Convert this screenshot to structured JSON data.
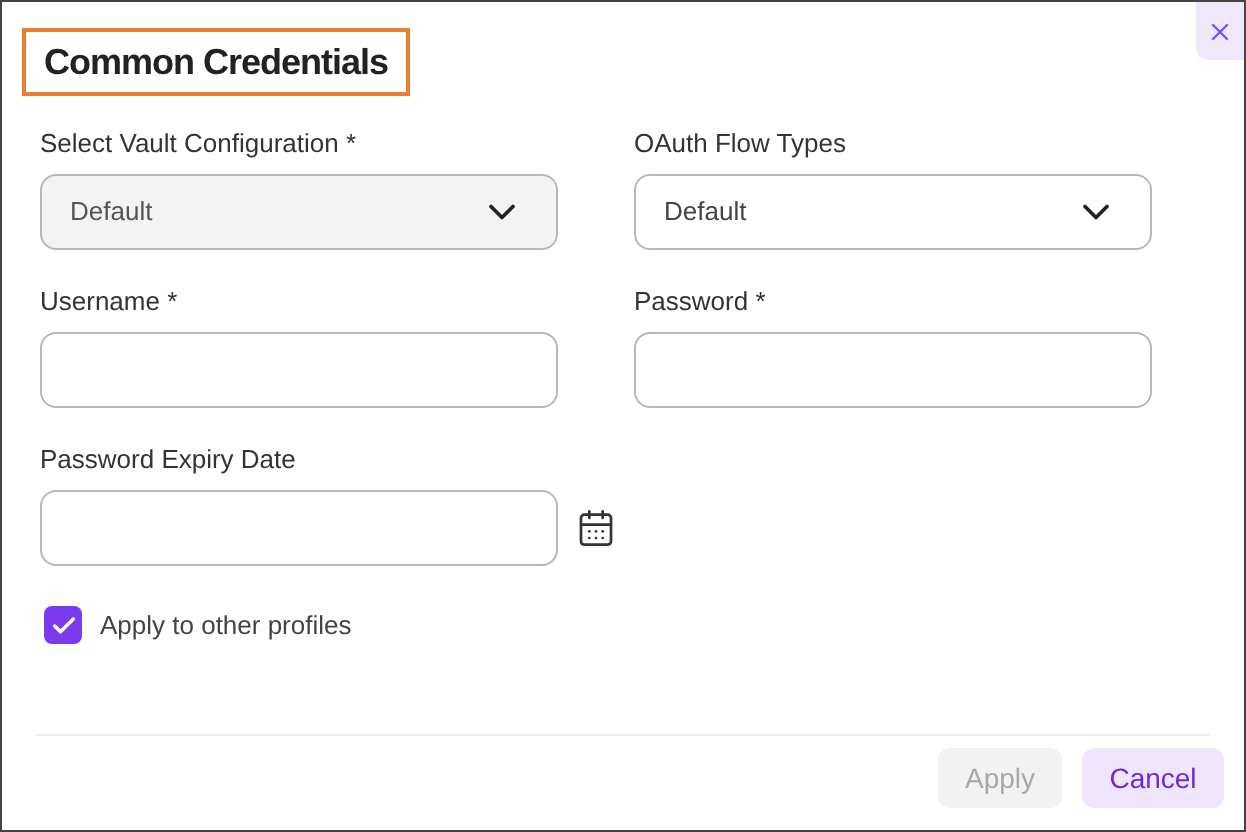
{
  "dialog": {
    "title": "Common Credentials",
    "title_highlighted": true
  },
  "fields": [
    {
      "kind": "select",
      "label": "Select Vault Configuration *",
      "value": "Default",
      "disabled": true
    },
    {
      "kind": "select",
      "label": "OAuth Flow Types",
      "value": "Default",
      "disabled": false
    },
    {
      "kind": "input",
      "label": "Username *"
    },
    {
      "kind": "input",
      "label": "Password *"
    },
    {
      "kind": "date",
      "label": "Password Expiry Date"
    }
  ],
  "apply_to_other_profiles": {
    "label": "Apply to other profiles",
    "checked": true
  },
  "buttons": [
    {
      "label": "Apply",
      "disabled": true,
      "kind": "secondary"
    },
    {
      "label": "Cancel",
      "disabled": false,
      "kind": "primary"
    }
  ]
}
